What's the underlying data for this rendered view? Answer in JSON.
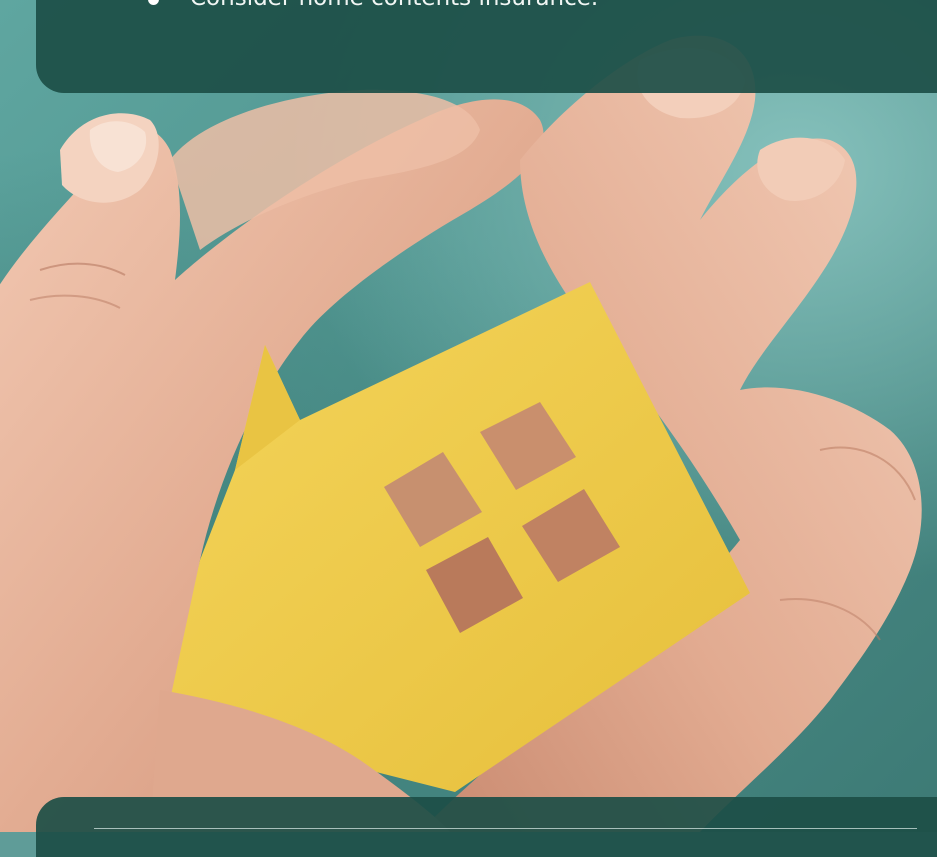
{
  "notice": {
    "bullets": [
      {
        "text": "Consider home contents insurance."
      }
    ]
  },
  "photo": {
    "subject": "paper-house-in-hands",
    "colors": {
      "background": "#5fa6a0",
      "panel": "#1c4e46",
      "house": "#f0cd4a",
      "skin": "#e6b49a"
    }
  }
}
